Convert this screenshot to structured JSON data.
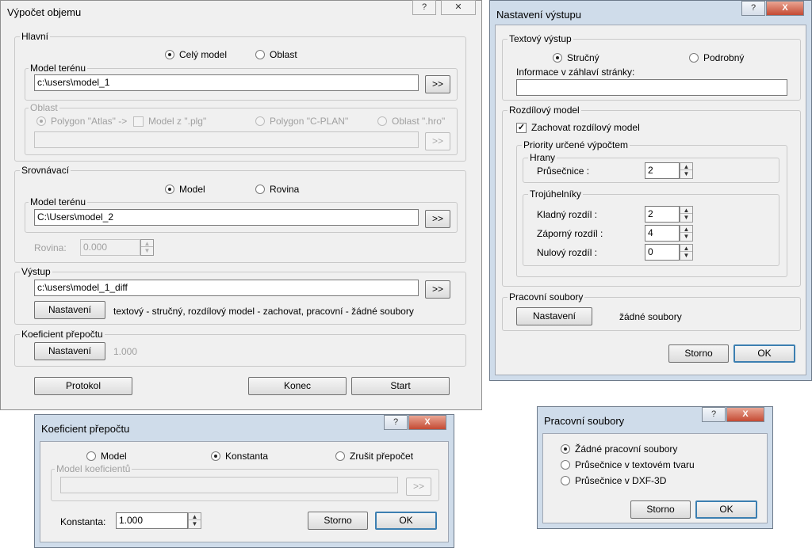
{
  "w1": {
    "title": "Výpočet objemu",
    "help": "?",
    "close": "✕",
    "hlavni": {
      "legend": "Hlavní",
      "radio_cely": "Celý model",
      "radio_oblast": "Oblast",
      "model_legend": "Model terénu",
      "model_path": "c:\\users\\model_1",
      "browse": ">>",
      "oblast_legend": "Oblast",
      "opt_atlas": "Polygon \"Atlas\" ->",
      "opt_plg": "Model z \".plg\"",
      "opt_cplan": "Polygon \"C-PLAN\"",
      "opt_hro": "Oblast \".hro\"",
      "oblast_path": "",
      "browse2": ">>"
    },
    "srovnavaci": {
      "legend": "Srovnávací",
      "radio_model": "Model",
      "radio_rovina": "Rovina",
      "model_legend": "Model terénu",
      "model_path": "C:\\Users\\model_2",
      "browse": ">>",
      "rovina_label": "Rovina:",
      "rovina_value": "0.000"
    },
    "vystup": {
      "legend": "Výstup",
      "path": "c:\\users\\model_1_diff",
      "browse": ">>",
      "settings_btn": "Nastavení",
      "summary": "textový - stručný,  rozdílový model - zachovat,  pracovní - žádné soubory"
    },
    "koef": {
      "legend": "Koeficient přepočtu",
      "settings_btn": "Nastavení",
      "value": "1.000"
    },
    "btn_protokol": "Protokol",
    "btn_konec": "Konec",
    "btn_start": "Start"
  },
  "w2": {
    "title": "Nastavení výstupu",
    "help": "?",
    "close": "X",
    "textovy": {
      "legend": "Textový výstup",
      "radio_strucny": "Stručný",
      "radio_podrobny": "Podrobný",
      "header_label": "Informace v záhlaví stránky:",
      "header_value": ""
    },
    "rozdilovy": {
      "legend": "Rozdílový model",
      "check_label": "Zachovat rozdílový model",
      "check_mark": "✓",
      "priority_legend": "Priority určené výpočtem",
      "hrany_legend": "Hrany",
      "prusecnice_label": "Průsečnice :",
      "prusecnice_value": "2",
      "troj_legend": "Trojúhelníky",
      "kladny_label": "Kladný rozdíl :",
      "kladny_value": "2",
      "zaporny_label": "Záporný rozdíl :",
      "zaporny_value": "4",
      "nulovy_label": "Nulový rozdíl :",
      "nulovy_value": "0"
    },
    "pracovni": {
      "legend": "Pracovní soubory",
      "settings_btn": "Nastavení",
      "value": "žádné soubory"
    },
    "btn_storno": "Storno",
    "btn_ok": "OK"
  },
  "w3": {
    "title": "Koeficient přepočtu",
    "help": "?",
    "close": "X",
    "radio_model": "Model",
    "radio_konstanta": "Konstanta",
    "radio_zrusit": "Zrušit přepočet",
    "model_legend": "Model koeficientů",
    "model_path": "",
    "browse": ">>",
    "konstanta_label": "Konstanta:",
    "konstanta_value": "1.000",
    "btn_storno": "Storno",
    "btn_ok": "OK"
  },
  "w4": {
    "title": "Pracovní soubory",
    "help": "?",
    "close": "X",
    "opt_zadne": "Žádné pracovní soubory",
    "opt_text": "Průsečnice v textovém tvaru",
    "opt_dxf": "Průsečnice v DXF-3D",
    "btn_storno": "Storno",
    "btn_ok": "OK"
  },
  "spin_up": "▲",
  "spin_down": "▼"
}
